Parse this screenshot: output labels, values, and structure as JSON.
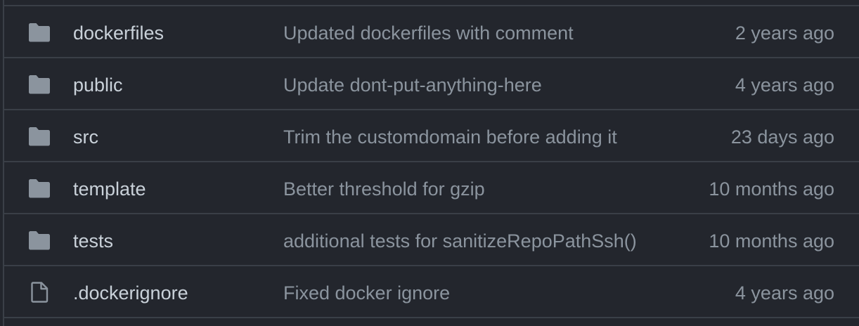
{
  "colors": {
    "background": "#23262d",
    "border": "#3a3f47",
    "name_text": "#c9d1d9",
    "muted_text": "#8b949e",
    "icon": "#8b949e"
  },
  "rows": [
    {
      "icon": "folder-icon",
      "name": "dockerfiles",
      "message": "Updated dockerfiles with comment",
      "age": "2 years ago"
    },
    {
      "icon": "folder-icon",
      "name": "public",
      "message": "Update dont-put-anything-here",
      "age": "4 years ago"
    },
    {
      "icon": "folder-icon",
      "name": "src",
      "message": "Trim the customdomain before adding it",
      "age": "23 days ago"
    },
    {
      "icon": "folder-icon",
      "name": "template",
      "message": "Better threshold for gzip",
      "age": "10 months ago"
    },
    {
      "icon": "folder-icon",
      "name": "tests",
      "message": "additional tests for sanitizeRepoPathSsh()",
      "age": "10 months ago"
    },
    {
      "icon": "file-icon",
      "name": ".dockerignore",
      "message": "Fixed docker ignore",
      "age": "4 years ago"
    }
  ]
}
